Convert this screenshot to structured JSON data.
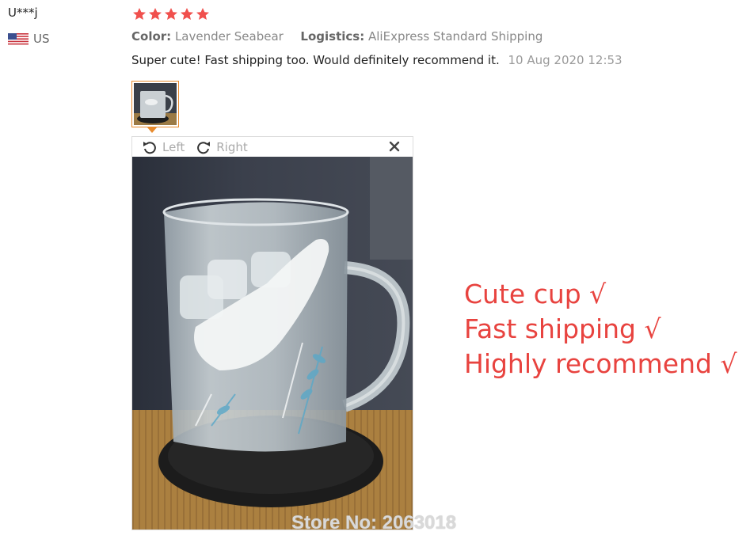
{
  "reviewer": {
    "name": "U***j",
    "country": "US",
    "flag_icon": "us-flag-icon"
  },
  "rating": {
    "stars": 5,
    "max": 5,
    "color": "#f0504d"
  },
  "meta": {
    "color_label": "Color:",
    "color_value": "Lavender Seabear",
    "logistics_label": "Logistics:",
    "logistics_value": "AliExpress Standard Shipping"
  },
  "review": {
    "text": "Super cute! Fast shipping too. Would definitely recommend it.",
    "date": "10 Aug 2020 12:53"
  },
  "viewer": {
    "rotate_left_label": "Left",
    "rotate_right_label": "Right",
    "close_icon": "close-icon"
  },
  "overlay": {
    "lines": [
      "Cute cup √",
      "Fast shipping √",
      "Highly recommend √"
    ],
    "color": "#e8433f"
  },
  "watermark": "Store No: 2063018",
  "colors": {
    "accent": "#e88b2e",
    "star": "#f0504d"
  }
}
